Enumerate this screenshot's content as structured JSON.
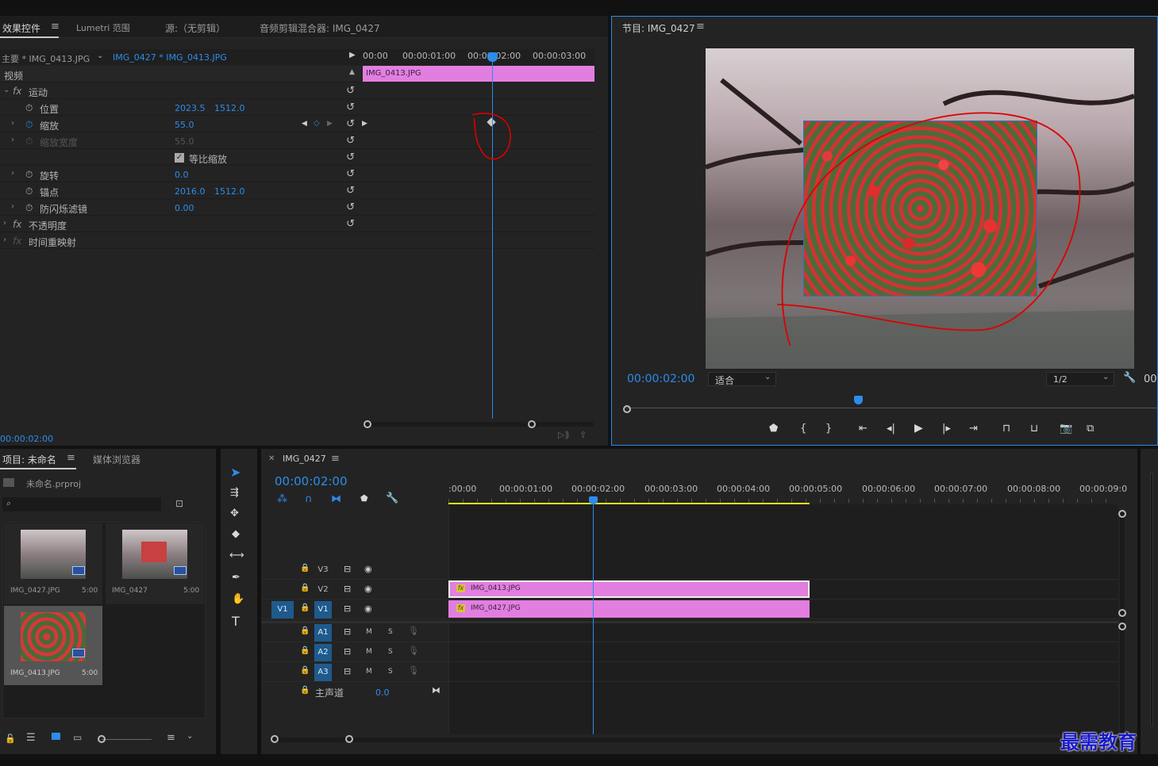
{
  "top_left_tabs": {
    "effect_controls": "效果控件",
    "lumetri": "Lumetri 范围",
    "source": "源:（无剪辑）",
    "audio_mixer": "音频剪辑混合器: IMG_0427"
  },
  "effect_controls": {
    "master_label": "主要 * IMG_0413.JPG",
    "sequence_label": "IMG_0427 * IMG_0413.JPG",
    "ruler": [
      "00:00",
      "00:00:01:00",
      "00:00:02:00",
      "00:00:03:00"
    ],
    "clip_name": "IMG_0413.JPG",
    "video_header": "视频",
    "motion": "运动",
    "position_label": "位置",
    "position_x": "2023.5",
    "position_y": "1512.0",
    "scale_label": "缩放",
    "scale_value": "55.0",
    "scale_width_label": "缩放宽度",
    "scale_width_value": "55.0",
    "uniform_scale": "等比缩放",
    "rotation_label": "旋转",
    "rotation_value": "0.0",
    "anchor_label": "锚点",
    "anchor_x": "2016.0",
    "anchor_y": "1512.0",
    "flicker_label": "防闪烁滤镜",
    "flicker_value": "0.00",
    "opacity": "不透明度",
    "time_remap": "时间重映射",
    "timecode": "00:00:02:00"
  },
  "program": {
    "title": "节目: IMG_0427",
    "timecode": "00:00:02:00",
    "fit": "适合",
    "quality": "1/2",
    "right_tc": "00"
  },
  "project": {
    "tab_project": "项目: 未命名",
    "tab_media": "媒体浏览器",
    "file_name": "未命名.prproj",
    "items": [
      {
        "name": "IMG_0427.JPG",
        "duration": "5:00"
      },
      {
        "name": "IMG_0427",
        "duration": "5:00"
      },
      {
        "name": "IMG_0413.JPG",
        "duration": "5:00"
      }
    ]
  },
  "timeline": {
    "sequence_tab": "IMG_0427",
    "timecode": "00:00:02:00",
    "ruler": [
      ":00:00",
      "00:00:01:00",
      "00:00:02:00",
      "00:00:03:00",
      "00:00:04:00",
      "00:00:05:00",
      "00:00:06:00",
      "00:00:07:00",
      "00:00:08:00",
      "00:00:09:0"
    ],
    "tracks": {
      "v3": "V3",
      "v2": "V2",
      "v1": "V1",
      "a1": "A1",
      "a2": "A2",
      "a3": "A3",
      "m": "M",
      "s": "S"
    },
    "source_v1": "V1",
    "master_label": "主声道",
    "master_value": "0.0",
    "clip_v2": "IMG_0413.JPG",
    "clip_v1": "IMG_0427.JPG",
    "fx": "fx"
  },
  "watermark": "最需教育"
}
